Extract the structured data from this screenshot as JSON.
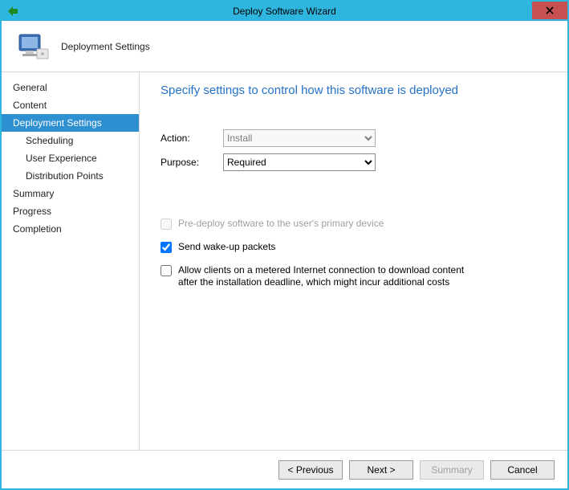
{
  "window": {
    "title": "Deploy Software Wizard"
  },
  "header": {
    "page_label": "Deployment Settings"
  },
  "sidebar": {
    "items": [
      {
        "label": "General",
        "child": false,
        "selected": false
      },
      {
        "label": "Content",
        "child": false,
        "selected": false
      },
      {
        "label": "Deployment Settings",
        "child": false,
        "selected": true
      },
      {
        "label": "Scheduling",
        "child": true,
        "selected": false
      },
      {
        "label": "User Experience",
        "child": true,
        "selected": false
      },
      {
        "label": "Distribution Points",
        "child": true,
        "selected": false
      },
      {
        "label": "Summary",
        "child": false,
        "selected": false
      },
      {
        "label": "Progress",
        "child": false,
        "selected": false
      },
      {
        "label": "Completion",
        "child": false,
        "selected": false
      }
    ]
  },
  "content": {
    "title": "Specify settings to control how this software is deployed",
    "action_label": "Action:",
    "action_value": "Install",
    "purpose_label": "Purpose:",
    "purpose_value": "Required",
    "cb_predeploy": "Pre-deploy software to the user's primary device",
    "cb_wakeup": "Send wake-up packets",
    "cb_metered": "Allow clients on a metered Internet connection to download content after the installation deadline, which might incur additional costs"
  },
  "footer": {
    "previous": "< Previous",
    "next": "Next >",
    "summary": "Summary",
    "cancel": "Cancel"
  }
}
